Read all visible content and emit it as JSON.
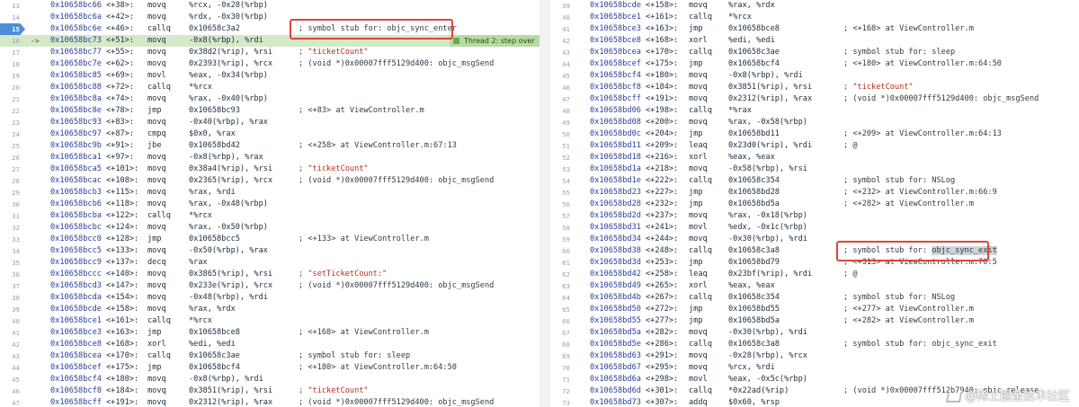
{
  "left": {
    "current_line": "16",
    "breakpoint_line": "15",
    "current_arrow": "->",
    "badge_text": "Thread 2: step over",
    "lines": [
      {
        "ln": "13",
        "addr": "0x10658bc66",
        "off": "<+38>:",
        "mn": "movq",
        "ops": "%rcx, -0x28(%rbp)",
        "cmt": ""
      },
      {
        "ln": "14",
        "addr": "0x10658bc6a",
        "off": "<+42>:",
        "mn": "movq",
        "ops": "%rdx, -0x30(%rbp)",
        "cmt": ""
      },
      {
        "ln": "15",
        "addr": "0x10658bc6e",
        "off": "<+46>:",
        "mn": "callq",
        "ops": "0x10658c3a2",
        "cmt": "; symbol stub for: objc_sync_enter"
      },
      {
        "ln": "16",
        "addr": "0x10658bc73",
        "off": "<+51>:",
        "mn": "movq",
        "ops": "-0x8(%rbp), %rdi",
        "cmt": ""
      },
      {
        "ln": "17",
        "addr": "0x10658bc77",
        "off": "<+55>:",
        "mn": "movq",
        "ops": "0x38d2(%rip), %rsi",
        "cmt": "; \"ticketCount\""
      },
      {
        "ln": "18",
        "addr": "0x10658bc7e",
        "off": "<+62>:",
        "mn": "movq",
        "ops": "0x2393(%rip), %rcx",
        "cmt": "; (void *)0x00007fff5129d400: objc_msgSend"
      },
      {
        "ln": "19",
        "addr": "0x10658bc85",
        "off": "<+69>:",
        "mn": "movl",
        "ops": "%eax, -0x34(%rbp)",
        "cmt": ""
      },
      {
        "ln": "20",
        "addr": "0x10658bc88",
        "off": "<+72>:",
        "mn": "callq",
        "ops": "*%rcx",
        "cmt": ""
      },
      {
        "ln": "21",
        "addr": "0x10658bc8a",
        "off": "<+74>:",
        "mn": "movq",
        "ops": "%rax, -0x40(%rbp)",
        "cmt": ""
      },
      {
        "ln": "22",
        "addr": "0x10658bc8e",
        "off": "<+78>:",
        "mn": "jmp",
        "ops": "0x10658bc93",
        "cmt": "; <+83> at ViewController.m"
      },
      {
        "ln": "23",
        "addr": "0x10658bc93",
        "off": "<+83>:",
        "mn": "movq",
        "ops": "-0x40(%rbp), %rax",
        "cmt": ""
      },
      {
        "ln": "24",
        "addr": "0x10658bc97",
        "off": "<+87>:",
        "mn": "cmpq",
        "ops": "$0x0, %rax",
        "cmt": ""
      },
      {
        "ln": "25",
        "addr": "0x10658bc9b",
        "off": "<+91>:",
        "mn": "jbe",
        "ops": "0x10658bd42",
        "cmt": "; <+258> at ViewController.m:67:13"
      },
      {
        "ln": "26",
        "addr": "0x10658bca1",
        "off": "<+97>:",
        "mn": "movq",
        "ops": "-0x8(%rbp), %rax",
        "cmt": ""
      },
      {
        "ln": "27",
        "addr": "0x10658bca5",
        "off": "<+101>:",
        "mn": "movq",
        "ops": "0x38a4(%rip), %rsi",
        "cmt": "; \"ticketCount\""
      },
      {
        "ln": "28",
        "addr": "0x10658bcac",
        "off": "<+108>:",
        "mn": "movq",
        "ops": "0x2365(%rip), %rcx",
        "cmt": "; (void *)0x00007fff5129d400: objc_msgSend"
      },
      {
        "ln": "29",
        "addr": "0x10658bcb3",
        "off": "<+115>:",
        "mn": "movq",
        "ops": "%rax, %rdi",
        "cmt": ""
      },
      {
        "ln": "30",
        "addr": "0x10658bcb6",
        "off": "<+118>:",
        "mn": "movq",
        "ops": "%rax, -0x48(%rbp)",
        "cmt": ""
      },
      {
        "ln": "31",
        "addr": "0x10658bcba",
        "off": "<+122>:",
        "mn": "callq",
        "ops": "*%rcx",
        "cmt": ""
      },
      {
        "ln": "32",
        "addr": "0x10658bcbc",
        "off": "<+124>:",
        "mn": "movq",
        "ops": "%rax, -0x50(%rbp)",
        "cmt": ""
      },
      {
        "ln": "33",
        "addr": "0x10658bcc0",
        "off": "<+128>:",
        "mn": "jmp",
        "ops": "0x10658bcc5",
        "cmt": "; <+133> at ViewController.m"
      },
      {
        "ln": "34",
        "addr": "0x10658bcc5",
        "off": "<+133>:",
        "mn": "movq",
        "ops": "-0x50(%rbp), %rax",
        "cmt": ""
      },
      {
        "ln": "35",
        "addr": "0x10658bcc9",
        "off": "<+137>:",
        "mn": "decq",
        "ops": "%rax",
        "cmt": ""
      },
      {
        "ln": "36",
        "addr": "0x10658bccc",
        "off": "<+140>:",
        "mn": "movq",
        "ops": "0x3865(%rip), %rsi",
        "cmt": "; \"setTicketCount:\""
      },
      {
        "ln": "37",
        "addr": "0x10658bcd3",
        "off": "<+147>:",
        "mn": "movq",
        "ops": "0x233e(%rip), %rcx",
        "cmt": "; (void *)0x00007fff5129d400: objc_msgSend"
      },
      {
        "ln": "38",
        "addr": "0x10658bcda",
        "off": "<+154>:",
        "mn": "movq",
        "ops": "-0x48(%rbp), %rdi",
        "cmt": ""
      },
      {
        "ln": "39",
        "addr": "0x10658bcde",
        "off": "<+158>:",
        "mn": "movq",
        "ops": "%rax, %rdx",
        "cmt": ""
      },
      {
        "ln": "40",
        "addr": "0x10658bce1",
        "off": "<+161>:",
        "mn": "callq",
        "ops": "*%rcx",
        "cmt": ""
      },
      {
        "ln": "41",
        "addr": "0x10658bce3",
        "off": "<+163>:",
        "mn": "jmp",
        "ops": "0x10658bce8",
        "cmt": "; <+168> at ViewController.m"
      },
      {
        "ln": "42",
        "addr": "0x10658bce8",
        "off": "<+168>:",
        "mn": "xorl",
        "ops": "%edi, %edi",
        "cmt": ""
      },
      {
        "ln": "43",
        "addr": "0x10658bcea",
        "off": "<+170>:",
        "mn": "callq",
        "ops": "0x10658c3ae",
        "cmt": "; symbol stub for: sleep"
      },
      {
        "ln": "44",
        "addr": "0x10658bcef",
        "off": "<+175>:",
        "mn": "jmp",
        "ops": "0x10658bcf4",
        "cmt": "; <+180> at ViewController.m:64:50"
      },
      {
        "ln": "45",
        "addr": "0x10658bcf4",
        "off": "<+180>:",
        "mn": "movq",
        "ops": "-0x8(%rbp), %rdi",
        "cmt": ""
      },
      {
        "ln": "46",
        "addr": "0x10658bcf8",
        "off": "<+184>:",
        "mn": "movq",
        "ops": "0x3851(%rip), %rsi",
        "cmt": "; \"ticketCount\""
      },
      {
        "ln": "47",
        "addr": "0x10658bcff",
        "off": "<+191>:",
        "mn": "movq",
        "ops": "0x2312(%rip), %rax",
        "cmt": "; (void *)0x00007fff5129d400: objc_msgSend"
      }
    ]
  },
  "right": {
    "current_line": "60",
    "highlight_symbol": "objc_sync_exit",
    "lines": [
      {
        "ln": "39",
        "addr": "0x10658bcde",
        "off": "<+158>:",
        "mn": "movq",
        "ops": "%rax, %rdx",
        "cmt": ""
      },
      {
        "ln": "40",
        "addr": "0x10658bce1",
        "off": "<+161>:",
        "mn": "callq",
        "ops": "*%rcx",
        "cmt": ""
      },
      {
        "ln": "41",
        "addr": "0x10658bce3",
        "off": "<+163>:",
        "mn": "jmp",
        "ops": "0x10658bce8",
        "cmt": "; <+168> at ViewController.m"
      },
      {
        "ln": "42",
        "addr": "0x10658bce8",
        "off": "<+168>:",
        "mn": "xorl",
        "ops": "%edi, %edi",
        "cmt": ""
      },
      {
        "ln": "43",
        "addr": "0x10658bcea",
        "off": "<+170>:",
        "mn": "callq",
        "ops": "0x10658c3ae",
        "cmt": "; symbol stub for: sleep"
      },
      {
        "ln": "44",
        "addr": "0x10658bcef",
        "off": "<+175>:",
        "mn": "jmp",
        "ops": "0x10658bcf4",
        "cmt": "; <+180> at ViewController.m:64:50"
      },
      {
        "ln": "45",
        "addr": "0x10658bcf4",
        "off": "<+180>:",
        "mn": "movq",
        "ops": "-0x8(%rbp), %rdi",
        "cmt": ""
      },
      {
        "ln": "46",
        "addr": "0x10658bcf8",
        "off": "<+184>:",
        "mn": "movq",
        "ops": "0x3851(%rip), %rsi",
        "cmt": "; \"ticketCount\""
      },
      {
        "ln": "47",
        "addr": "0x10658bcff",
        "off": "<+191>:",
        "mn": "movq",
        "ops": "0x2312(%rip), %rax",
        "cmt": "; (void *)0x00007fff5129d400: objc_msgSend"
      },
      {
        "ln": "48",
        "addr": "0x10658bd06",
        "off": "<+198>:",
        "mn": "callq",
        "ops": "*%rax",
        "cmt": ""
      },
      {
        "ln": "49",
        "addr": "0x10658bd08",
        "off": "<+200>:",
        "mn": "movq",
        "ops": "%rax, -0x58(%rbp)",
        "cmt": ""
      },
      {
        "ln": "50",
        "addr": "0x10658bd0c",
        "off": "<+204>:",
        "mn": "jmp",
        "ops": "0x10658bd11",
        "cmt": "; <+209> at ViewController.m:64:13"
      },
      {
        "ln": "51",
        "addr": "0x10658bd11",
        "off": "<+209>:",
        "mn": "leaq",
        "ops": "0x23d0(%rip), %rdi",
        "cmt": "; @"
      },
      {
        "ln": "52",
        "addr": "0x10658bd18",
        "off": "<+216>:",
        "mn": "xorl",
        "ops": "%eax, %eax",
        "cmt": ""
      },
      {
        "ln": "53",
        "addr": "0x10658bd1a",
        "off": "<+218>:",
        "mn": "movq",
        "ops": "-0x58(%rbp), %rsi",
        "cmt": ""
      },
      {
        "ln": "54",
        "addr": "0x10658bd1e",
        "off": "<+222>:",
        "mn": "callq",
        "ops": "0x10658c354",
        "cmt": "; symbol stub for: NSLog"
      },
      {
        "ln": "55",
        "addr": "0x10658bd23",
        "off": "<+227>:",
        "mn": "jmp",
        "ops": "0x10658bd28",
        "cmt": "; <+232> at ViewController.m:66:9"
      },
      {
        "ln": "56",
        "addr": "0x10658bd28",
        "off": "<+232>:",
        "mn": "jmp",
        "ops": "0x10658bd5a",
        "cmt": "; <+282> at ViewController.m"
      },
      {
        "ln": "57",
        "addr": "0x10658bd2d",
        "off": "<+237>:",
        "mn": "movq",
        "ops": "%rax, -0x18(%rbp)",
        "cmt": ""
      },
      {
        "ln": "58",
        "addr": "0x10658bd31",
        "off": "<+241>:",
        "mn": "movl",
        "ops": "%edx, -0x1c(%rbp)",
        "cmt": ""
      },
      {
        "ln": "59",
        "addr": "0x10658bd34",
        "off": "<+244>:",
        "mn": "movq",
        "ops": "-0x30(%rbp), %rdi",
        "cmt": ""
      },
      {
        "ln": "60",
        "addr": "0x10658bd38",
        "off": "<+248>:",
        "mn": "callq",
        "ops": "0x10658c3a8",
        "cmt": "; symbol stub for: objc_sync_exit"
      },
      {
        "ln": "61",
        "addr": "0x10658bd3d",
        "off": "<+253>:",
        "mn": "jmp",
        "ops": "0x10658bd79",
        "cmt": "; <+313> at ViewController.m:70:5"
      },
      {
        "ln": "62",
        "addr": "0x10658bd42",
        "off": "<+258>:",
        "mn": "leaq",
        "ops": "0x23bf(%rip), %rdi",
        "cmt": "; @"
      },
      {
        "ln": "63",
        "addr": "0x10658bd49",
        "off": "<+265>:",
        "mn": "xorl",
        "ops": "%eax, %eax",
        "cmt": ""
      },
      {
        "ln": "64",
        "addr": "0x10658bd4b",
        "off": "<+267>:",
        "mn": "callq",
        "ops": "0x10658c354",
        "cmt": "; symbol stub for: NSLog"
      },
      {
        "ln": "65",
        "addr": "0x10658bd50",
        "off": "<+272>:",
        "mn": "jmp",
        "ops": "0x10658bd55",
        "cmt": "; <+277> at ViewController.m"
      },
      {
        "ln": "66",
        "addr": "0x10658bd55",
        "off": "<+277>:",
        "mn": "jmp",
        "ops": "0x10658bd5a",
        "cmt": "; <+282> at ViewController.m"
      },
      {
        "ln": "67",
        "addr": "0x10658bd5a",
        "off": "<+282>:",
        "mn": "movq",
        "ops": "-0x30(%rbp), %rdi",
        "cmt": ""
      },
      {
        "ln": "68",
        "addr": "0x10658bd5e",
        "off": "<+286>:",
        "mn": "callq",
        "ops": "0x10658c3a8",
        "cmt": "; symbol stub for: objc_sync_exit"
      },
      {
        "ln": "69",
        "addr": "0x10658bd63",
        "off": "<+291>:",
        "mn": "movq",
        "ops": "-0x28(%rbp), %rcx",
        "cmt": ""
      },
      {
        "ln": "70",
        "addr": "0x10658bd67",
        "off": "<+295>:",
        "mn": "movq",
        "ops": "%rcx, %rdi",
        "cmt": ""
      },
      {
        "ln": "71",
        "addr": "0x10658bd6a",
        "off": "<+298>:",
        "mn": "movl",
        "ops": "%eax, -0x5c(%rbp)",
        "cmt": ""
      },
      {
        "ln": "72",
        "addr": "0x10658bd6d",
        "off": "<+301>:",
        "mn": "callq",
        "ops": "*0x22ad(%rip)",
        "cmt": "; (void *)0x00007fff512b7940: objc_release"
      },
      {
        "ln": "73",
        "addr": "0x10658bd73",
        "off": "<+307>:",
        "mn": "addq",
        "ops": "$0x60, %rsp",
        "cmt": ""
      }
    ]
  },
  "watermark": "@稀土掘金技术社区",
  "colors": {
    "current_line_bg": "#d4e9c7",
    "breakpoint": "#4d8fd6",
    "annotation_box": "#e0433a",
    "address": "#2a3f9a",
    "string_literal": "#b0301b"
  }
}
